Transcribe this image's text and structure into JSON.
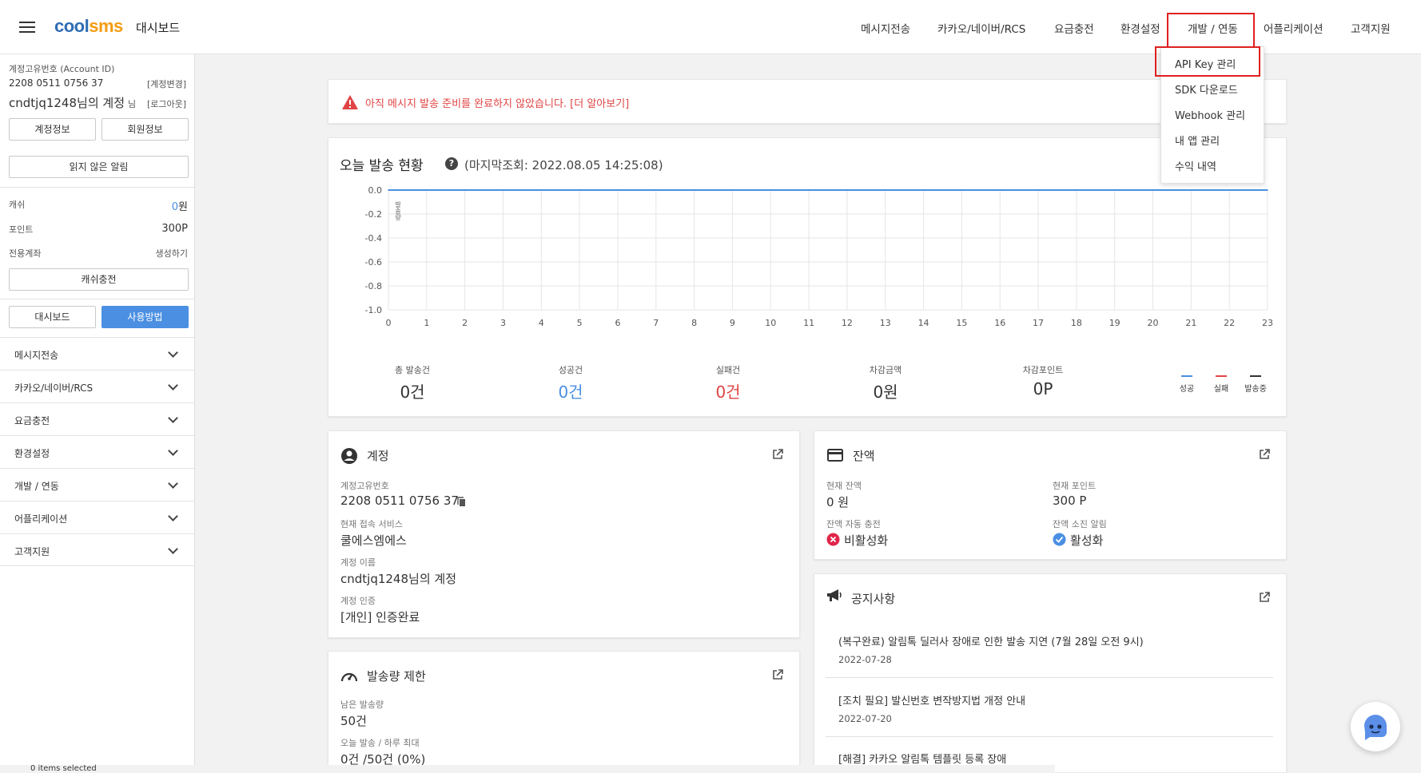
{
  "header": {
    "logo_text_a": "cool",
    "logo_text_b": "sms",
    "page_title": "대시보드",
    "nav": [
      "메시지전송",
      "카카오/네이버/RCS",
      "요금충전",
      "환경설정",
      "개발 / 연동",
      "어플리케이션",
      "고객지원"
    ]
  },
  "dropdown": {
    "items": [
      "API Key 관리",
      "SDK 다운로드",
      "Webhook 관리",
      "내 앱 관리",
      "수익 내역"
    ]
  },
  "sidebar": {
    "account_id_label": "계정고유번호 (Account ID)",
    "account_id": "2208 0511 0756 37",
    "change_account": "[계정변경]",
    "account_name": "cndtjq1248님의 계정",
    "name_suffix": "님",
    "logout": "[로그아웃]",
    "btn_account_info": "계정정보",
    "btn_member_info": "회원정보",
    "btn_unread": "읽지 않은 알림",
    "cash_label": "캐쉬",
    "cash_value": "0",
    "cash_unit": "원",
    "point_label": "포인트",
    "point_value": "300P",
    "dedicated_label": "전용계좌",
    "dedicated_action": "생성하기",
    "btn_charge": "캐쉬충전",
    "btn_dashboard": "대시보드",
    "btn_howto": "사용방법",
    "menu": [
      "메시지전송",
      "카카오/네이버/RCS",
      "요금충전",
      "환경설정",
      "개발 / 연동",
      "어플리케이션",
      "고객지원"
    ]
  },
  "warning": {
    "text": "아직 메시지 발송 준비를 완료하지 않았습니다. [더 알아보기]"
  },
  "today": {
    "title": "오늘 발송 현황",
    "last_checked": "(마지막조회: 2022.08.05 14:25:08)",
    "stats": [
      {
        "label": "총 발송건",
        "value": "0건"
      },
      {
        "label": "성공건",
        "value": "0건"
      },
      {
        "label": "실패건",
        "value": "0건"
      },
      {
        "label": "차감금액",
        "value": "0원"
      },
      {
        "label": "차감포인트",
        "value": "0P"
      }
    ],
    "legend": [
      {
        "label": "성공",
        "color": "#4a8fe2"
      },
      {
        "label": "실패",
        "color": "#e04444"
      },
      {
        "label": "발송중",
        "color": "#333333"
      }
    ]
  },
  "chart_data": {
    "type": "line",
    "x": [
      0,
      1,
      2,
      3,
      4,
      5,
      6,
      7,
      8,
      9,
      10,
      11,
      12,
      13,
      14,
      15,
      16,
      17,
      18,
      19,
      20,
      21,
      22,
      23
    ],
    "series": [
      {
        "values": [
          0,
          0,
          0,
          0,
          0,
          0,
          0,
          0,
          0,
          0,
          0,
          0,
          0,
          0,
          0,
          0,
          0,
          0,
          0,
          0,
          0,
          0,
          0,
          0
        ],
        "color": "#4a8fe2"
      }
    ],
    "y_ticks": [
      "0.0",
      "-0.2",
      "-0.4",
      "-0.6",
      "-0.8",
      "-1.0"
    ],
    "x_ticks": [
      "0",
      "1",
      "2",
      "3",
      "4",
      "5",
      "6",
      "7",
      "8",
      "9",
      "10",
      "11",
      "12",
      "13",
      "14",
      "15",
      "16",
      "17",
      "18",
      "19",
      "20",
      "21",
      "22",
      "23"
    ],
    "ylim": [
      -1.0,
      0.0
    ],
    "xlim": [
      0,
      23
    ],
    "grid": true,
    "annotation": "발송량"
  },
  "account": {
    "title": "계정",
    "id_label": "계정고유번호",
    "id_value": "2208 0511 0756 37",
    "service_label": "현재 접속 서비스",
    "service_value": "쿨에스엠에스",
    "name_label": "계정 이름",
    "name_value": "cndtjq1248님의 계정",
    "verify_label": "계정 인증",
    "verify_value": "[개인] 인증완료"
  },
  "balance": {
    "title": "잔액",
    "cur_balance_label": "현재 잔액",
    "cur_balance_value": "0 원",
    "cur_point_label": "현재 포인트",
    "cur_point_value": "300 P",
    "auto_charge_label": "잔액 자동 충전",
    "auto_charge_value": "비활성화",
    "depletion_label": "잔액 소진 알림",
    "depletion_value": "활성화"
  },
  "limit": {
    "title": "발송량 제한",
    "remaining_label": "남은 발송량",
    "remaining_value": "50건",
    "today_label": "오늘 발송 / 하루 최대",
    "today_value": "0건 /50건 (0%)"
  },
  "notices": {
    "title": "공지사항",
    "items": [
      {
        "title": "(복구완료) 알림톡 딜러사 장애로 인한 발송 지연 (7월 28일 오전 9시)",
        "date": "2022-07-28"
      },
      {
        "title": "[조치 필요] 발신번호 변작방지법 개정 안내",
        "date": "2022-07-20"
      },
      {
        "title": "[해결] 카카오 알림톡 템플릿 등록 장애",
        "date": ""
      }
    ]
  },
  "taskbar": {
    "items_selected": "0 items selected"
  }
}
